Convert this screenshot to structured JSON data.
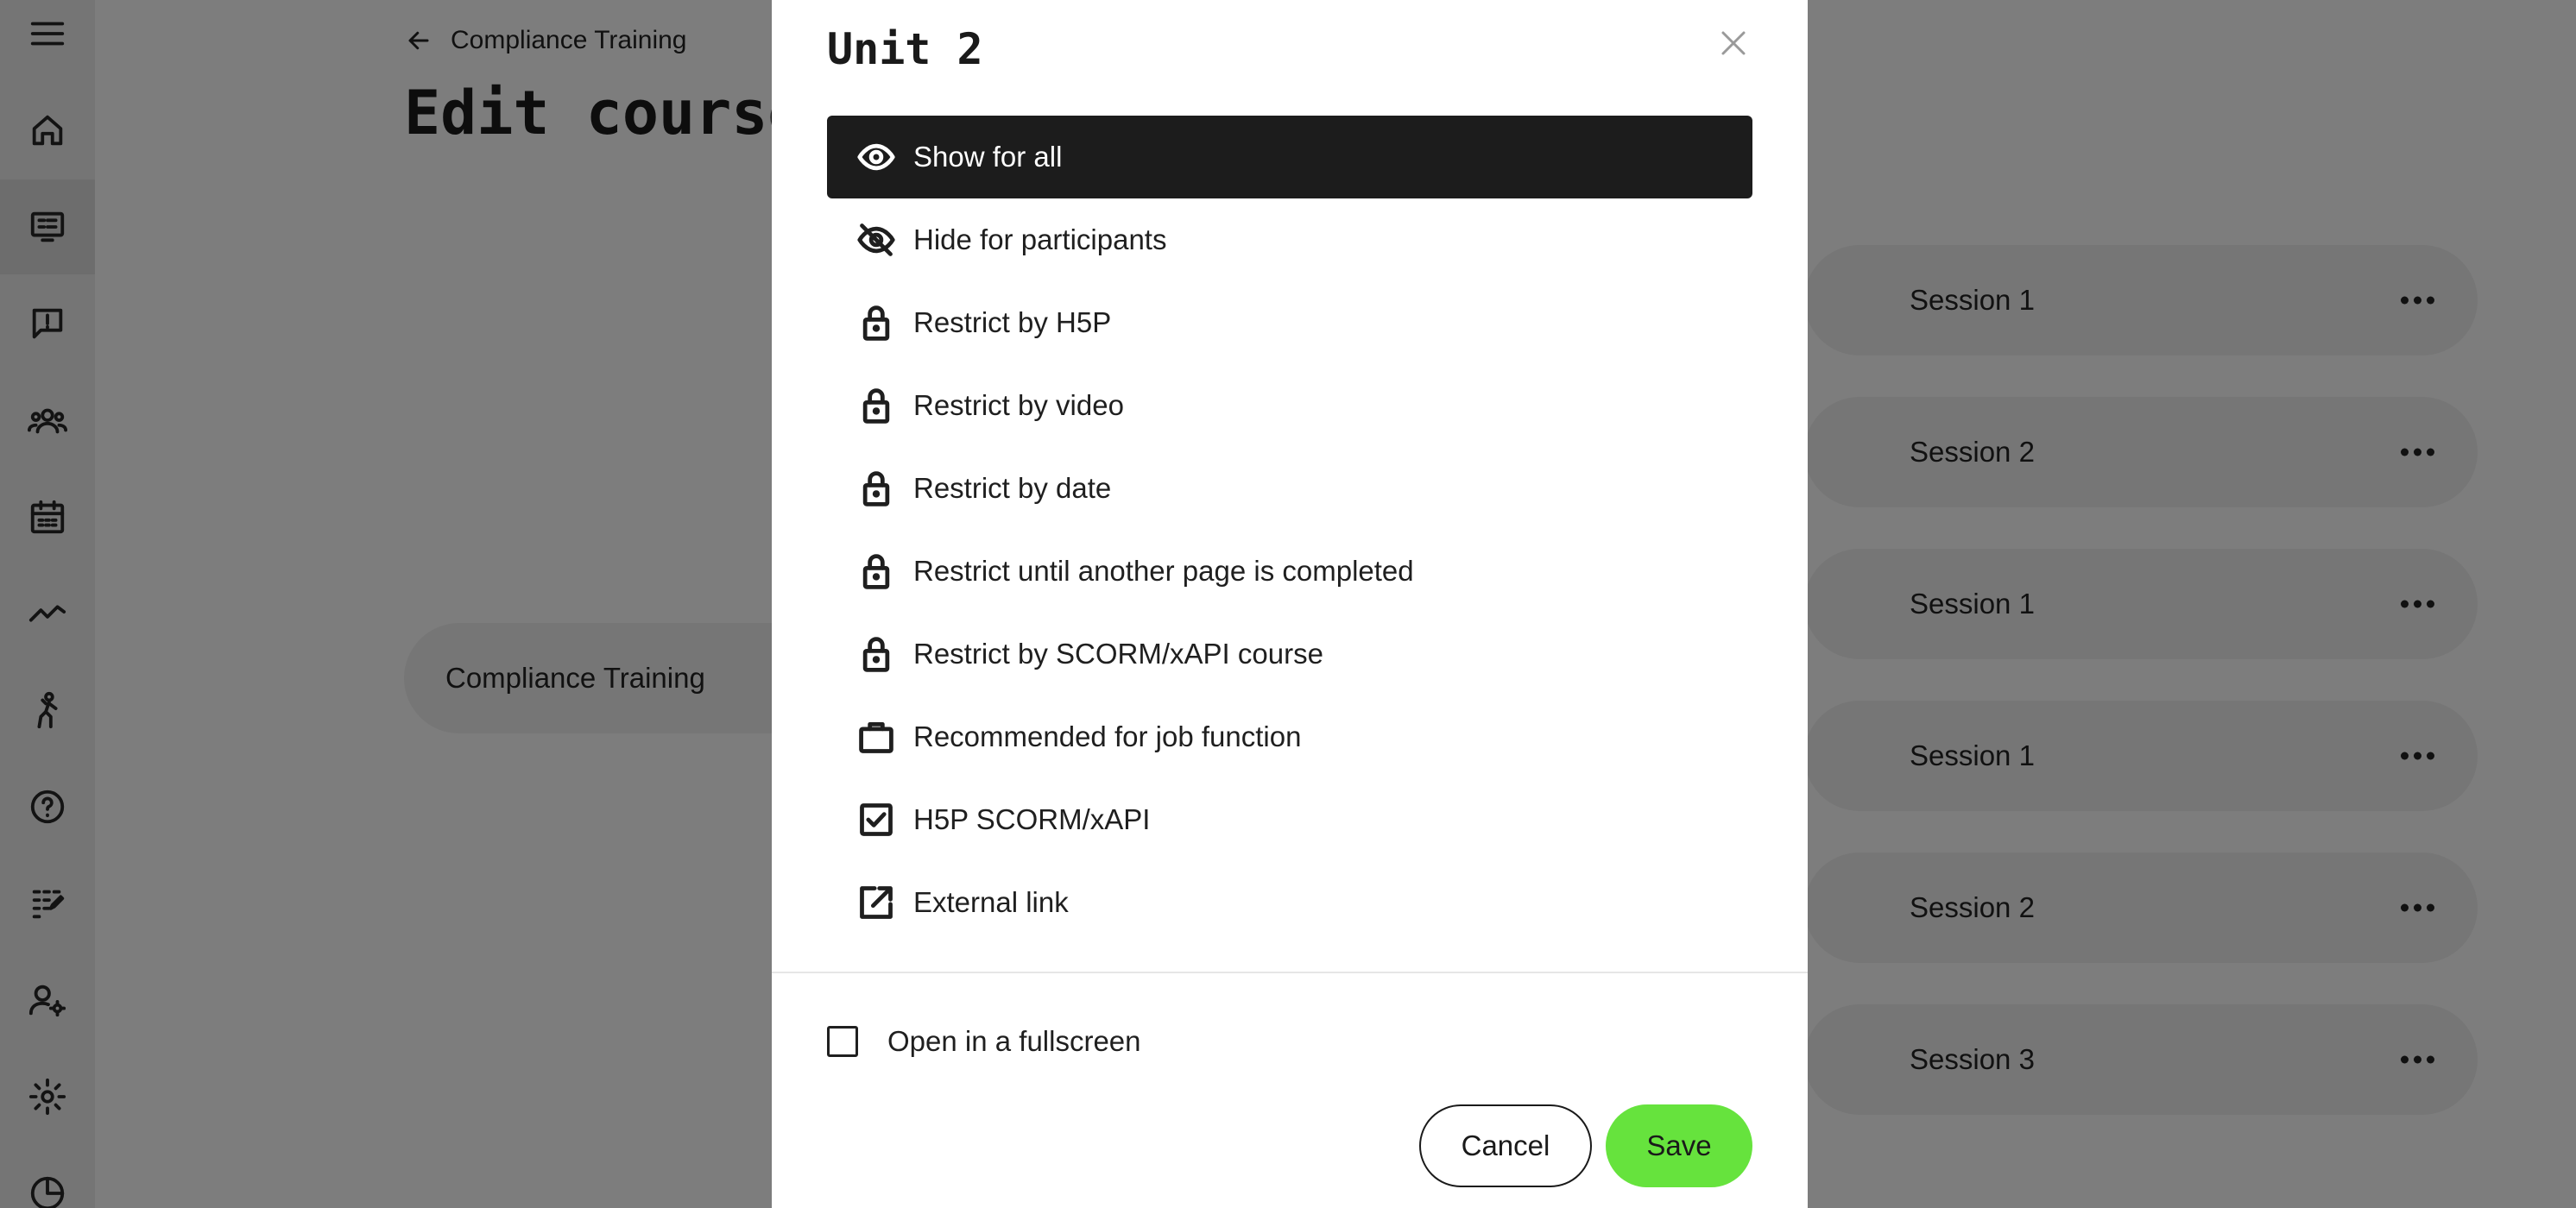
{
  "header": {
    "back_label": "Compliance Training",
    "page_title": "Edit course"
  },
  "course_card": {
    "label": "Compliance Training"
  },
  "sessions": [
    {
      "label": "Session 1"
    },
    {
      "label": "Session 2"
    },
    {
      "label": "Session 1"
    },
    {
      "label": "Session 1"
    },
    {
      "label": "Session 2"
    },
    {
      "label": "Session 3"
    }
  ],
  "sidebar": {
    "items": [
      {
        "icon": "menu-icon"
      },
      {
        "icon": "home-icon"
      },
      {
        "icon": "courses-icon",
        "active": true
      },
      {
        "icon": "feedback-icon"
      },
      {
        "icon": "users-icon"
      },
      {
        "icon": "calendar-icon"
      },
      {
        "icon": "analytics-icon"
      },
      {
        "icon": "activity-icon"
      },
      {
        "icon": "help-icon"
      },
      {
        "icon": "apps-icon"
      },
      {
        "icon": "user-settings-icon"
      },
      {
        "icon": "settings-icon"
      },
      {
        "icon": "reports-icon"
      }
    ]
  },
  "modal": {
    "title": "Unit 2",
    "options": [
      {
        "label": "Show for all",
        "icon": "eye-icon",
        "selected": true
      },
      {
        "label": "Hide for participants",
        "icon": "eye-off-icon"
      },
      {
        "label": "Restrict by H5P",
        "icon": "lock-icon"
      },
      {
        "label": "Restrict by video",
        "icon": "lock-icon"
      },
      {
        "label": "Restrict by date",
        "icon": "lock-icon"
      },
      {
        "label": "Restrict until another page is completed",
        "icon": "lock-icon"
      },
      {
        "label": "Restrict by SCORM/xAPI course",
        "icon": "lock-icon"
      },
      {
        "label": "Recommended for job function",
        "icon": "briefcase-icon"
      },
      {
        "label": "H5P SCORM/xAPI",
        "icon": "checkbox-checked-icon"
      },
      {
        "label": "External link",
        "icon": "external-link-icon"
      }
    ],
    "fullscreen_label": "Open in a fullscreen",
    "fullscreen_checked": false,
    "cancel_label": "Cancel",
    "save_label": "Save"
  },
  "colors": {
    "selected_bg": "#1c1c1c",
    "save_button": "#66e33d",
    "overlay": "rgba(0,0,0,0.5)"
  }
}
